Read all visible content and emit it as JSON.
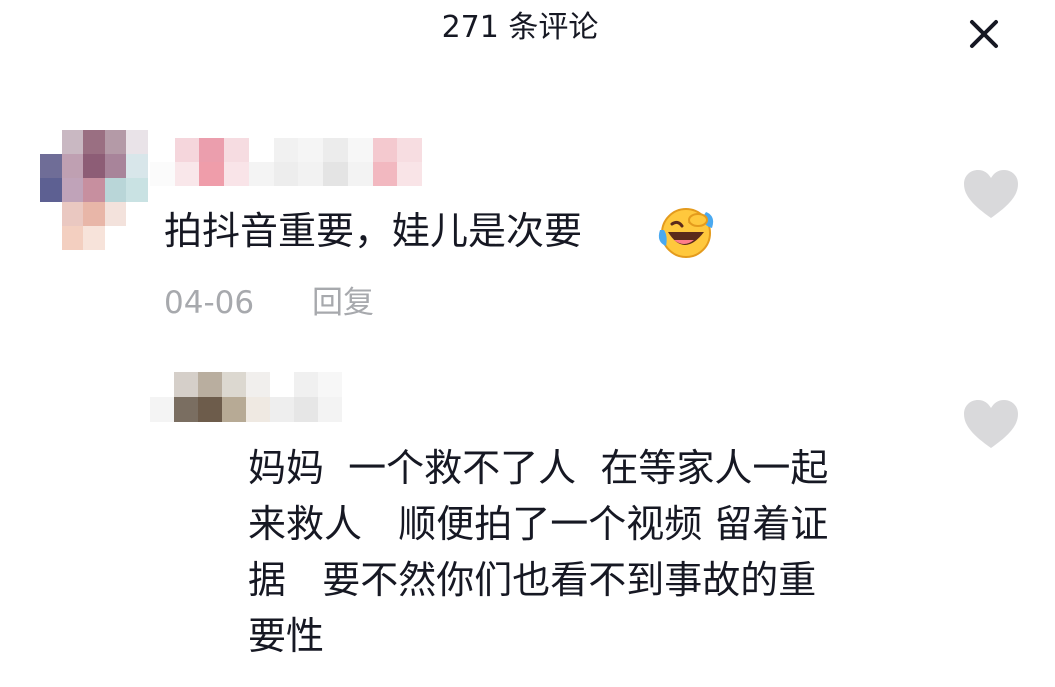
{
  "header": {
    "title": "271 条评论",
    "close_icon": "close-icon"
  },
  "comment": {
    "username": "",
    "text": "拍抖音重要，娃儿是次要",
    "emoji": "laughing-crying-emoji",
    "date": "04-06",
    "reply_label": "回复",
    "like_icon": "heart-icon"
  },
  "reply": {
    "username": "",
    "lines": [
      "妈妈  一个救不了人  在等家人一起",
      "来救人   顺便拍了一个视频 留着证",
      "据   要不然你们也看不到事故的重",
      "要性"
    ],
    "like_icon": "heart-icon"
  },
  "colors": {
    "text": "#161823",
    "meta": "#a7a9ad",
    "heart": "#d9d9db",
    "background": "#ffffff"
  }
}
